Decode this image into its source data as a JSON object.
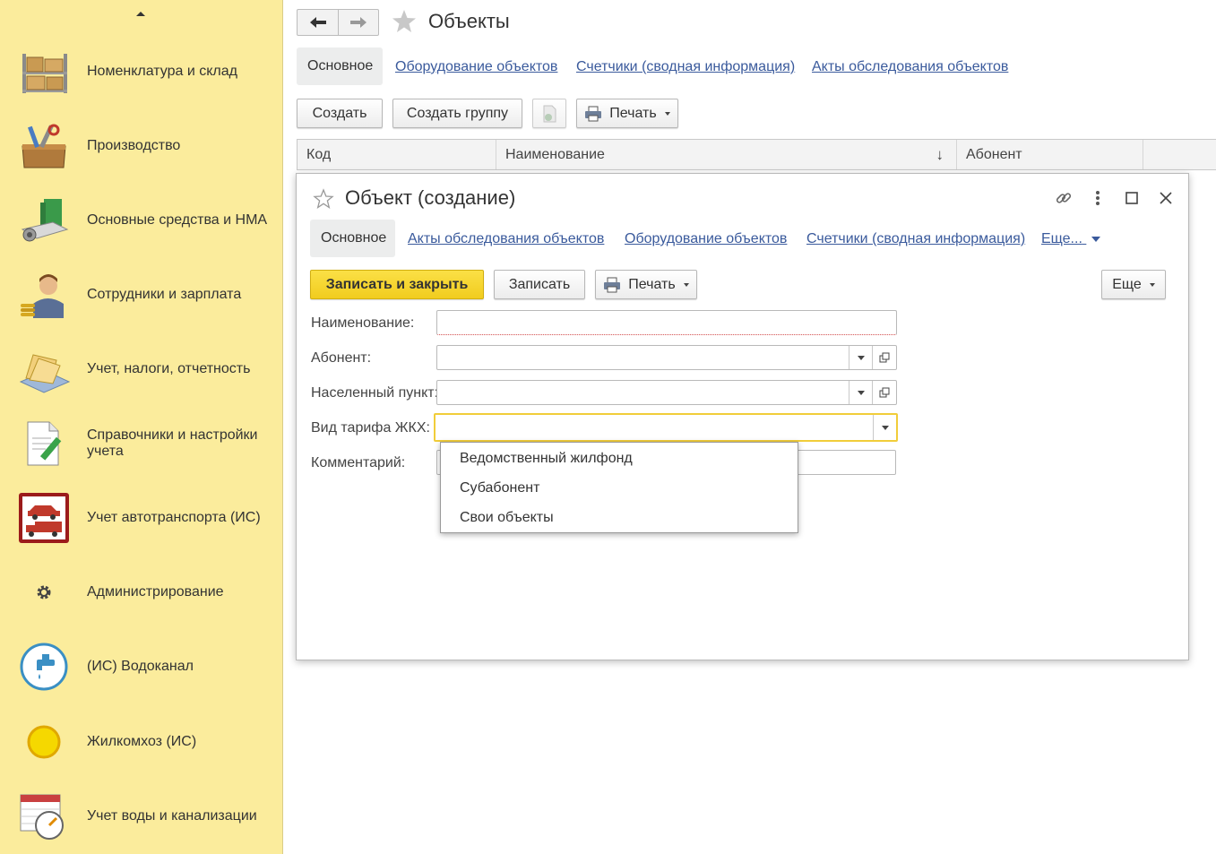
{
  "sidebar": {
    "items": [
      {
        "label": "Номенклатура и склад",
        "icon": "warehouse-shelf-icon"
      },
      {
        "label": "Производство",
        "icon": "toolbox-icon"
      },
      {
        "label": "Основные средства и НМА",
        "icon": "equipment-icon"
      },
      {
        "label": "Сотрудники и зарплата",
        "icon": "employee-coins-icon"
      },
      {
        "label": "Учет, налоги, отчетность",
        "icon": "folder-documents-icon"
      },
      {
        "label": "Справочники и настройки учета",
        "icon": "document-pencil-icon"
      },
      {
        "label": "Учет автотранспорта (ИС)",
        "icon": "vehicles-icon"
      },
      {
        "label": "Администрирование",
        "icon": "gear-icon"
      },
      {
        "label": "(ИС) Водоканал",
        "icon": "water-tap-icon"
      },
      {
        "label": "Жилкомхоз (ИС)",
        "icon": "yellow-circle-icon"
      },
      {
        "label": "Учет воды и канализации",
        "icon": "calendar-clock-icon"
      }
    ]
  },
  "main": {
    "title": "Объекты",
    "tabs": [
      {
        "label": "Основное",
        "active": true
      },
      {
        "label": "Оборудование объектов"
      },
      {
        "label": "Счетчики (сводная информация)"
      },
      {
        "label": "Акты обследования объектов"
      }
    ],
    "toolbar": {
      "create": "Создать",
      "create_group": "Создать группу",
      "print": "Печать"
    },
    "table": {
      "columns": [
        "Код",
        "Наименование",
        "Абонент"
      ],
      "sort_indicator": "↓"
    }
  },
  "dialog": {
    "title": "Объект (создание)",
    "tabs": [
      {
        "label": "Основное",
        "active": true
      },
      {
        "label": "Акты обследования объектов"
      },
      {
        "label": "Оборудование объектов"
      },
      {
        "label": "Счетчики (сводная информация)"
      },
      {
        "label": "Еще..."
      }
    ],
    "toolbar": {
      "save_close": "Записать и закрыть",
      "save": "Записать",
      "print": "Печать",
      "more": "Еще"
    },
    "fields": {
      "name_label": "Наименование:",
      "name_value": "",
      "subscriber_label": "Абонент:",
      "subscriber_value": "",
      "locality_label": "Населенный пункт:",
      "locality_value": "",
      "tariff_label": "Вид тарифа ЖКХ:",
      "tariff_value": "",
      "comment_label": "Комментарий:",
      "comment_value": ""
    },
    "tariff_options": [
      "Ведомственный жилфонд",
      "Субабонент",
      "Свои объекты"
    ]
  },
  "colors": {
    "sidebar_bg": "#fbec9c",
    "primary_button": "#f5d22b",
    "link": "#3a5a9c",
    "focus_border": "#f1cd3a"
  }
}
